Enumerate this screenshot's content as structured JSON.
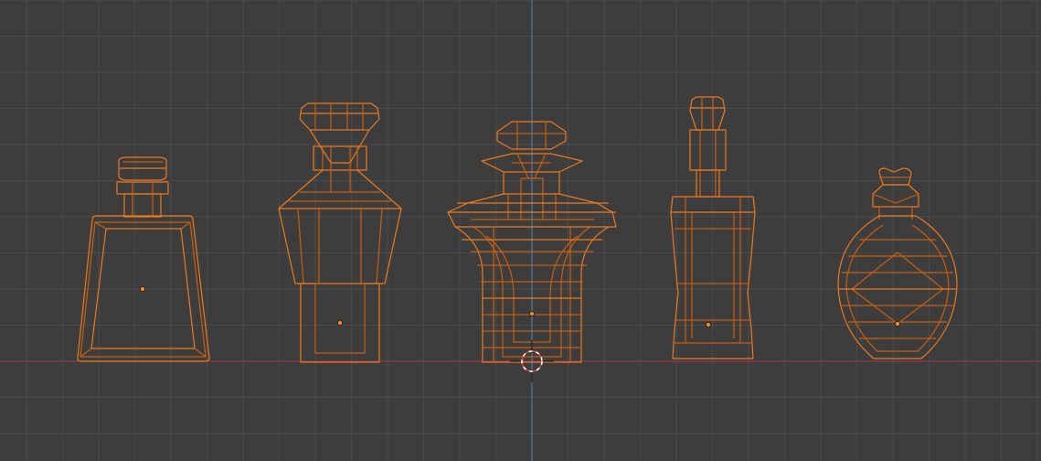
{
  "viewport": {
    "view": "front-orthographic",
    "shading": "wireframe",
    "colors": {
      "background": "#3d3d3d",
      "grid_line": "#4a4a4a",
      "grid_major": "#515151",
      "x_axis": "#8e3b4c",
      "z_axis": "#4f74a6",
      "selected_wire": "#ec7a1f",
      "selected_wire_inner": "#c75f12",
      "origin_dot": "#f08a2c",
      "cursor_red": "#e04040",
      "cursor_white": "#ffffff"
    }
  },
  "objects": [
    {
      "id": "bottle-1",
      "shape": "square-flask",
      "selected": true
    },
    {
      "id": "bottle-2",
      "shape": "gem-stopper-decanter",
      "selected": true
    },
    {
      "id": "bottle-3",
      "shape": "flared-vase",
      "selected": true
    },
    {
      "id": "bottle-4",
      "shape": "tall-neck-bottle",
      "selected": true
    },
    {
      "id": "bottle-5",
      "shape": "round-potion-bottle",
      "selected": true
    }
  ],
  "cursor_3d": {
    "icon": "3d-cursor-icon"
  }
}
